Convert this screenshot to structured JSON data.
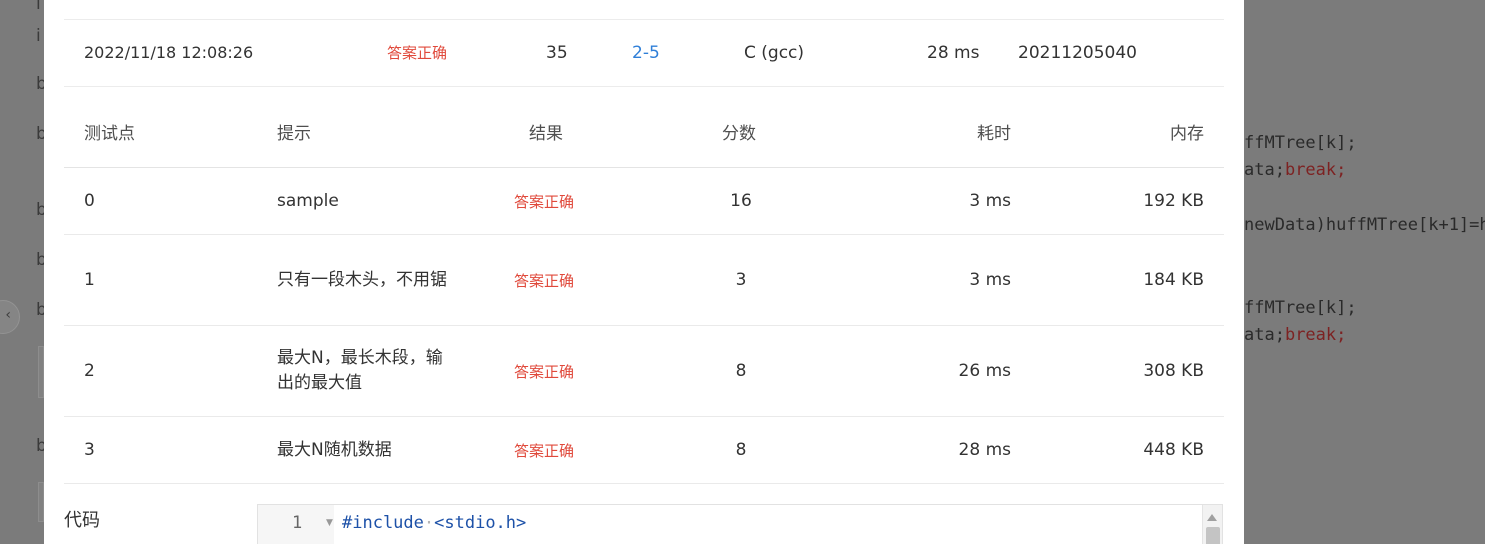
{
  "submission": {
    "time": "2022/11/18 12:08:26",
    "status": "答案正确",
    "score": "35",
    "problem": "2-5",
    "compiler": "C (gcc)",
    "duration": "28 ms",
    "user": "20211205040"
  },
  "table": {
    "headers": {
      "case": "测试点",
      "hint": "提示",
      "result": "结果",
      "score": "分数",
      "time": "耗时",
      "memory": "内存"
    },
    "rows": [
      {
        "case": "0",
        "hint": "sample",
        "result": "答案正确",
        "score": "16",
        "time": "3 ms",
        "memory": "192 KB"
      },
      {
        "case": "1",
        "hint": "只有一段木头，不用锯",
        "result": "答案正确",
        "score": "3",
        "time": "3 ms",
        "memory": "184 KB"
      },
      {
        "case": "2",
        "hint": "最大N，最长木段，输出的最大值",
        "result": "答案正确",
        "score": "8",
        "time": "26 ms",
        "memory": "308 KB"
      },
      {
        "case": "3",
        "hint": "最大N随机数据",
        "result": "答案正确",
        "score": "8",
        "time": "28 ms",
        "memory": "448 KB"
      }
    ]
  },
  "code": {
    "label": "代码",
    "line_number": "1",
    "first_line_keyword": "#include",
    "first_line_header": "<stdio.h>"
  },
  "background": {
    "left_glyphs": [
      "i",
      "i",
      "b",
      "b",
      "b",
      "b",
      "b",
      "b",
      "b"
    ],
    "code_lines": [
      {
        "a": "ffMTree[k];",
        "b": ""
      },
      {
        "a": "ata;",
        "b": "break;"
      },
      {
        "a": "newData)huffMTree[k+1]=h",
        "b": ""
      },
      {
        "a": "ffMTree[k];",
        "b": ""
      },
      {
        "a": "ata;",
        "b": "break;"
      }
    ]
  },
  "colors": {
    "status_ok": "#e0493b",
    "link": "#2f7fd8",
    "code_keyword": "#1d51a8",
    "overlay": "#7b7b7b"
  }
}
